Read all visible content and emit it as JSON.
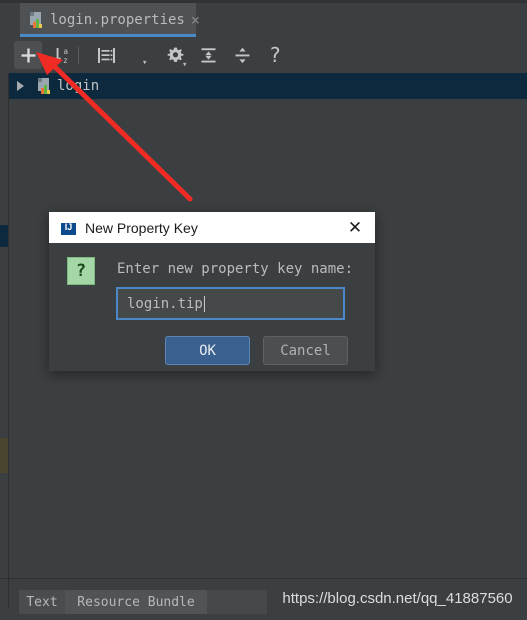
{
  "window": {
    "theme_bg": "#3c3f41",
    "accent": "#4a88c7"
  },
  "editor_tabs": [
    {
      "label": "login.properties",
      "icon": "properties-file-icon",
      "close_label": "×",
      "selected": true
    }
  ],
  "gutter": {
    "line_number": "0"
  },
  "toolbar": {
    "buttons": [
      {
        "name": "add-property-button",
        "icon": "plus-icon",
        "tooltip": "Add Property"
      },
      {
        "name": "sort-button",
        "icon": "sort-az-icon",
        "tooltip": "Sort"
      },
      {
        "name": "show-text-button",
        "icon": "document-list-icon",
        "tooltip": "Show Properties"
      },
      {
        "name": "settings-button",
        "icon": "gear-icon",
        "tooltip": "Settings"
      },
      {
        "name": "expand-all-button",
        "icon": "expand-all-icon",
        "tooltip": "Expand All"
      },
      {
        "name": "collapse-all-button",
        "icon": "collapse-all-icon",
        "tooltip": "Collapse All"
      },
      {
        "name": "help-button",
        "icon": "question-mark-icon",
        "label": "?"
      }
    ]
  },
  "tree": {
    "rows": [
      {
        "label": "login",
        "icon": "properties-file-icon",
        "expander": "collapsed-triangle",
        "selected": true
      }
    ]
  },
  "dialog": {
    "title": "New Property Key",
    "title_icon": "intellij-idea-icon",
    "title_icon_text": "IJ",
    "close_label": "✕",
    "message_icon": "question-icon",
    "message_icon_glyph": "?",
    "message": "Enter new property key name:",
    "input": {
      "value": "login.tip",
      "placeholder": ""
    },
    "buttons": {
      "ok": "OK",
      "cancel": "Cancel"
    }
  },
  "bottom_tabs": [
    {
      "label": "Text",
      "selected": false
    },
    {
      "label": "Resource Bundle",
      "selected": true
    }
  ],
  "watermark": {
    "text": "https://blog.csdn.net/qq_41887560"
  },
  "annotation": {
    "arrow_color": "#ef2b24"
  }
}
